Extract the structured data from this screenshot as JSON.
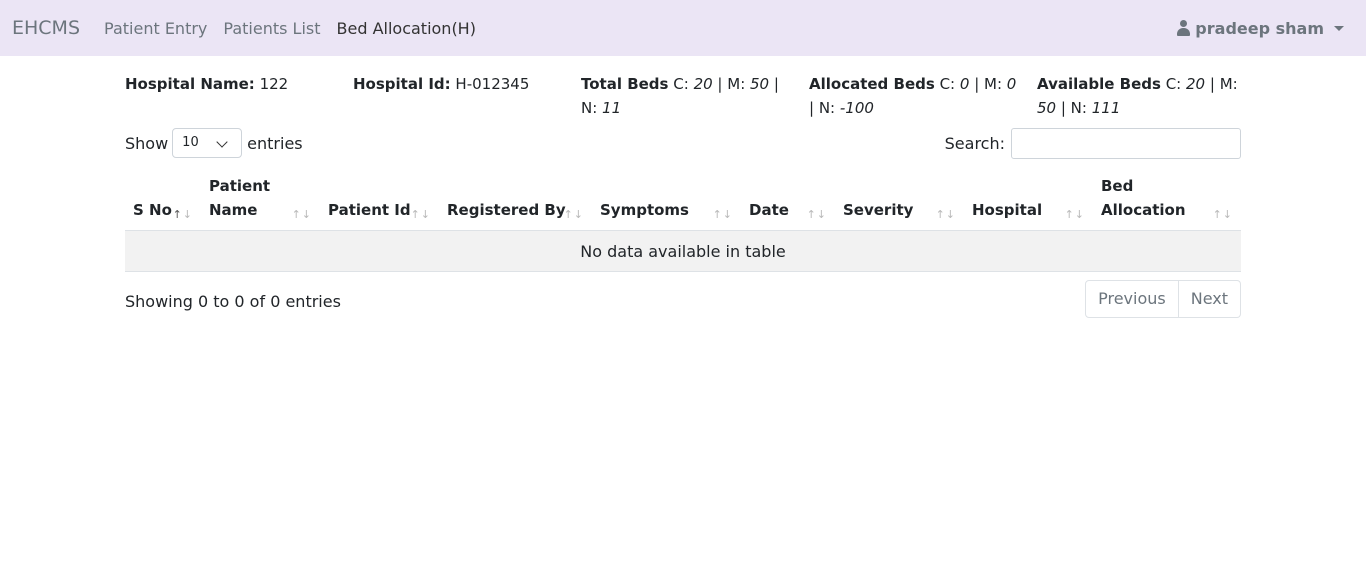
{
  "navbar": {
    "brand": "EHCMS",
    "links": [
      "Patient Entry",
      "Patients List",
      "Bed Allocation(H)"
    ],
    "user": "pradeep sham"
  },
  "info": {
    "hospital_name_label": "Hospital Name:",
    "hospital_name": "122",
    "hospital_id_label": "Hospital Id:",
    "hospital_id": "H-012345",
    "total_beds": {
      "label": "Total Beds",
      "c": "20",
      "m": "50",
      "n": "11"
    },
    "allocated_beds": {
      "label": "Allocated Beds",
      "c": "0",
      "m": "0",
      "n": "-100"
    },
    "available_beds": {
      "label": "Available Beds",
      "c": "20",
      "m": "50",
      "n": "111"
    }
  },
  "controls": {
    "show_label": "Show",
    "entries_value": "10",
    "entries_label": "entries",
    "search_label": "Search:",
    "search_value": ""
  },
  "table": {
    "headers": [
      "S No",
      "Patient Name",
      "Patient Id",
      "Registered By",
      "Symptoms",
      "Date",
      "Severity",
      "Hospital",
      "Bed Allocation"
    ],
    "empty_message": "No data available in table"
  },
  "footer": {
    "showing": "Showing 0 to 0 of 0 entries",
    "previous": "Previous",
    "next": "Next"
  },
  "colors": {
    "navbar_bg": "#ebe5f5",
    "muted": "#6c757d",
    "row_bg": "#f2f2f2"
  }
}
